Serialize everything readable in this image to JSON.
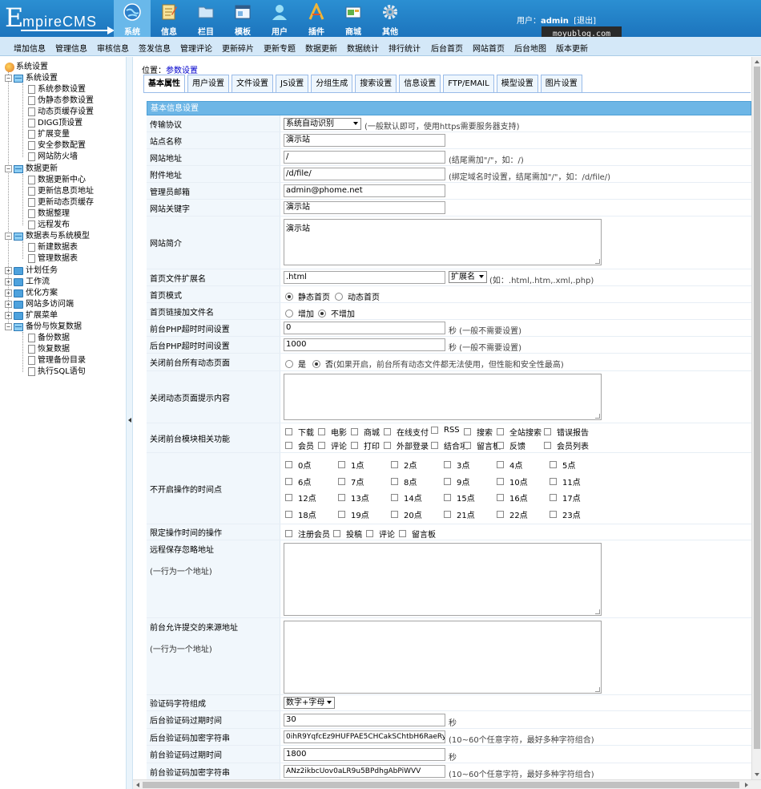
{
  "header": {
    "logo": {
      "big": "E",
      "rest": "mpireCMS"
    },
    "nav": [
      {
        "label": "系统",
        "icon": "globe-icon",
        "active": true
      },
      {
        "label": "信息",
        "icon": "notepad-icon"
      },
      {
        "label": "栏目",
        "icon": "folder-icon"
      },
      {
        "label": "模板",
        "icon": "window-icon"
      },
      {
        "label": "用户",
        "icon": "user-icon"
      },
      {
        "label": "插件",
        "icon": "tools-icon"
      },
      {
        "label": "商城",
        "icon": "shop-icon"
      },
      {
        "label": "其他",
        "icon": "gear-icon"
      }
    ],
    "user_prefix": "用户：",
    "username": "admin",
    "logout": "[退出]",
    "watermark": "moyublog.com"
  },
  "subnav": [
    "增加信息",
    "管理信息",
    "审核信息",
    "签发信息",
    "管理评论",
    "更新碎片",
    "更新专题",
    "数据更新",
    "数据统计",
    "排行统计",
    "后台首页",
    "网站首页",
    "后台地图",
    "版本更新"
  ],
  "sidebar": {
    "root": "系统设置",
    "groups": [
      {
        "label": "系统设置",
        "open": true,
        "items": [
          "系统参数设置",
          "伪静态参数设置",
          "动态页缓存设置",
          "DIGG顶设置",
          "扩展变量",
          "安全参数配置",
          "网站防火墙"
        ]
      },
      {
        "label": "数据更新",
        "open": true,
        "items": [
          "数据更新中心",
          "更新信息页地址",
          "更新动态页缓存",
          "数据整理",
          "远程发布"
        ]
      },
      {
        "label": "数据表与系统模型",
        "open": true,
        "items": [
          "新建数据表",
          "管理数据表"
        ]
      },
      {
        "label": "计划任务",
        "open": false,
        "items": []
      },
      {
        "label": "工作流",
        "open": false,
        "items": []
      },
      {
        "label": "优化方案",
        "open": false,
        "items": []
      },
      {
        "label": "网站多访问端",
        "open": false,
        "items": []
      },
      {
        "label": "扩展菜单",
        "open": false,
        "items": []
      },
      {
        "label": "备份与恢复数据",
        "open": true,
        "items": [
          "备份数据",
          "恢复数据",
          "管理备份目录",
          "执行SQL语句"
        ]
      }
    ]
  },
  "location": {
    "prefix": "位置：",
    "value": "参数设置"
  },
  "tabs": [
    "基本属性",
    "用户设置",
    "文件设置",
    "JS设置",
    "分组生成",
    "搜索设置",
    "信息设置",
    "FTP/EMAIL",
    "模型设置",
    "图片设置"
  ],
  "form": {
    "section_title": "基本信息设置",
    "protocol": {
      "label": "传输协议",
      "value": "系统自动识别",
      "hint": "(一般默认即可，使用https需要服务器支持)"
    },
    "site_name": {
      "label": "站点名称",
      "value": "演示站"
    },
    "site_url": {
      "label": "网站地址",
      "value": "/",
      "hint": "(结尾需加\"/\"，如：/)"
    },
    "attach_url": {
      "label": "附件地址",
      "value": "/d/file/",
      "hint": "(绑定域名时设置，结尾需加\"/\"，如：/d/file/)"
    },
    "admin_email": {
      "label": "管理员邮箱",
      "value": "admin@phome.net"
    },
    "keywords": {
      "label": "网站关键字",
      "value": "演示站"
    },
    "intro": {
      "label": "网站简介",
      "value": "演示站"
    },
    "index_ext": {
      "label": "首页文件扩展名",
      "value": ".html",
      "select": "扩展名",
      "hint": "(如：.html,.htm,.xml,.php)"
    },
    "index_mode": {
      "label": "首页模式",
      "options": [
        "静态首页",
        "动态首页"
      ],
      "selected": 0
    },
    "index_link": {
      "label": "首页链接加文件名",
      "options": [
        "增加",
        "不增加"
      ],
      "selected": 1
    },
    "front_timeout": {
      "label": "前台PHP超时时间设置",
      "value": "0",
      "hint": "秒 (一般不需要设置)"
    },
    "back_timeout": {
      "label": "后台PHP超时时间设置",
      "value": "1000",
      "hint": "秒 (一般不需要设置)"
    },
    "close_dynamic": {
      "label": "关闭前台所有动态页面",
      "options": [
        "是",
        "否"
      ],
      "selected": 1,
      "hint": "(如果开启，前台所有动态文件都无法使用，但性能和安全性最高)"
    },
    "close_msg": {
      "label": "关闭动态页面提示内容",
      "value": ""
    },
    "close_modules": {
      "label": "关闭前台模块相关功能",
      "row1": [
        "下载",
        "电影",
        "商城",
        "在线支付",
        "RSS",
        "搜索",
        "全站搜索",
        "错误报告"
      ],
      "row2": [
        "会员",
        "评论",
        "打印",
        "外部登录",
        "结合项",
        "留言板",
        "反馈",
        "会员列表"
      ]
    },
    "hours": {
      "label": "不开启操作的时间点",
      "items": [
        "0点",
        "1点",
        "2点",
        "3点",
        "4点",
        "5点",
        "6点",
        "7点",
        "8点",
        "9点",
        "10点",
        "11点",
        "12点",
        "13点",
        "14点",
        "15点",
        "16点",
        "17点",
        "18点",
        "19点",
        "20点",
        "21点",
        "22点",
        "23点"
      ]
    },
    "limit_ops": {
      "label": "限定操作时间的操作",
      "items": [
        "注册会员",
        "投稿",
        "评论",
        "留言板"
      ]
    },
    "remote_ignore": {
      "label": "远程保存忽略地址",
      "sub": "(一行为一个地址)",
      "value": ""
    },
    "allowed_sources": {
      "label": "前台允许提交的来源地址",
      "sub": "(一行为一个地址)",
      "value": ""
    },
    "captcha_chars": {
      "label": "验证码字符组成",
      "value": "数字+字母"
    },
    "back_captcha_expire": {
      "label": "后台验证码过期时间",
      "value": "30",
      "hint": "秒"
    },
    "back_captcha_key": {
      "label": "后台验证码加密字符串",
      "value": "0ihR9YqfcEz9HUFPAE5CHCakSChtbH6RaeRy",
      "hint": "(10~60个任意字符，最好多种字符组合)"
    },
    "front_captcha_expire": {
      "label": "前台验证码过期时间",
      "value": "1800",
      "hint": "秒"
    },
    "front_captcha_key": {
      "label": "前台验证码加密字符串",
      "value": "ANz2ikbcUov0aLR9u5BPdhgAbPiWVV",
      "hint": "(10~60个任意字符，最好多种字符组合)"
    }
  }
}
